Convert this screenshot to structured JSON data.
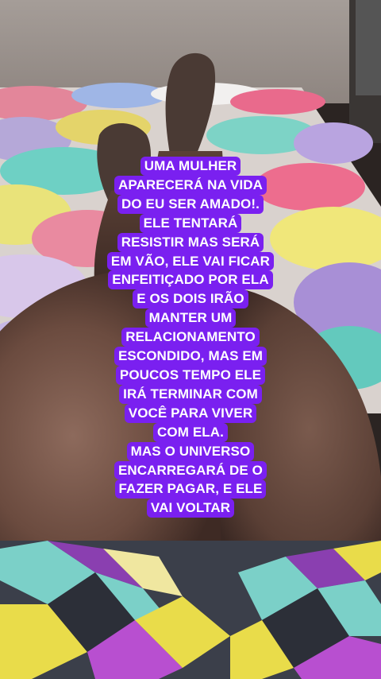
{
  "story": {
    "caption_lines": [
      "UMA MULHER",
      "APARECERÁ NA VIDA",
      "DO EU SER AMADO!.",
      "ELE TENTARÁ",
      "RESISTIR MAS SERÁ",
      "EM VÃO, ELE VAI FICAR",
      "ENFEITIÇADO POR ELA",
      "E OS DOIS IRÃO",
      "MANTER UM",
      "RELACIONAMENTO",
      "ESCONDIDO, MAS EM",
      "POUCOS TEMPO ELE",
      "IRÁ TERMINAR COM",
      "VOCÊ PARA VIVER",
      "COM ELA.",
      "MAS O UNIVERSO",
      "ENCARREGARÁ DE O",
      "FAZER PAGAR, E ELE",
      "VAI VOLTAR"
    ],
    "caption_background": "#7a20f0",
    "caption_text_color": "#ffffff"
  }
}
